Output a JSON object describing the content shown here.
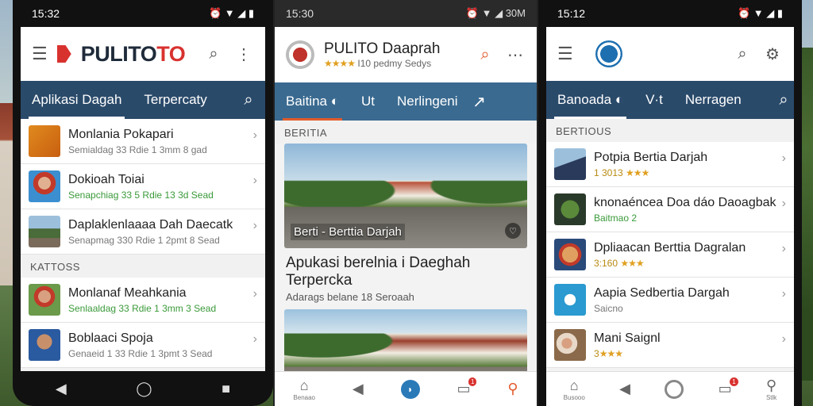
{
  "phone1": {
    "status": {
      "time": "15:32",
      "icons": "⏰ ▼ ◢ ▮"
    },
    "app_title_a": "PULITO",
    "app_title_b": "TO",
    "tabs": [
      "Aplikasi Dagah",
      "Terpercaty"
    ],
    "items": [
      {
        "title": "Monlania Pokapari",
        "sub": "Semialdag 33 Rdie 1 3mm 8 gad",
        "sub_color": "gray"
      },
      {
        "title": "Dokioah Toiai",
        "sub": "Senapchiag 33 5 Rdie 13 3d Sead",
        "sub_color": "green"
      },
      {
        "title": "Daplaklenlaaaa Dah Daecatk",
        "sub": "Senapmag 330 Rdie 1 2pmt 8 Sead",
        "sub_color": "gray"
      }
    ],
    "section": "KATTOSS",
    "items2": [
      {
        "title": "Monlanaf Meahkania",
        "sub": "Senlaaldag 33 Rdie 1 3mm 3 Sead",
        "sub_color": "green"
      },
      {
        "title": "Boblaaci Spoja",
        "sub": "Genaeid 1 33 Rdie 1 3pmt 3 Sead",
        "sub_color": "gray"
      }
    ]
  },
  "phone2": {
    "status": {
      "time": "15:30",
      "icons": "⏰ ▼ ◢ 30M"
    },
    "app_name": "PULITO Daaprah",
    "app_rating": "★★★★",
    "app_meta": "I10 pedmy Sedys",
    "tabs": [
      "Baitina",
      "Ut",
      "Nerlingeni"
    ],
    "section": "BERITIA",
    "image_caption": "Berti - Berttia Darjah",
    "article_title": "Apukasi berelnia i Daeghah Terpercka",
    "article_sub": "Adarags belane 18 Seroaah"
  },
  "phone3": {
    "status": {
      "time": "15:12",
      "icons": "⏰ ▼ ◢ ▮"
    },
    "tabs": [
      "Banoada",
      "V·t",
      "Nerragen"
    ],
    "section": "BERTIOUS",
    "items": [
      {
        "title": "Potpia Bertia Darjah",
        "sub": "1 3013",
        "stars": "★★★",
        "sub_color": "gold"
      },
      {
        "title": "knonaéncea Doa dáo Daoagbak",
        "sub": "Baitmao 2",
        "stars": "",
        "sub_color": "green"
      },
      {
        "title": "Dpliaacan Berttia Dagralan",
        "sub": "3:160",
        "stars": "★★★",
        "sub_color": "gold"
      },
      {
        "title": "Aapia Sedbertia Dargah",
        "sub": "Saicno",
        "stars": "",
        "sub_color": "gray"
      },
      {
        "title": "Mani Saignl",
        "sub": "3",
        "stars": "★★★",
        "sub_color": "gold"
      }
    ],
    "nav_labels": {
      "home": "Busooo",
      "profile": "Stlk"
    }
  },
  "phone2_nav": {
    "home": "Benaao",
    "badge": "1"
  },
  "phone3_badge": "1",
  "colors": {
    "tab_bar": "#2a4a6a",
    "accent_red": "#d8322f",
    "accent_orange": "#e25b2c",
    "green": "#3a9a3a"
  }
}
